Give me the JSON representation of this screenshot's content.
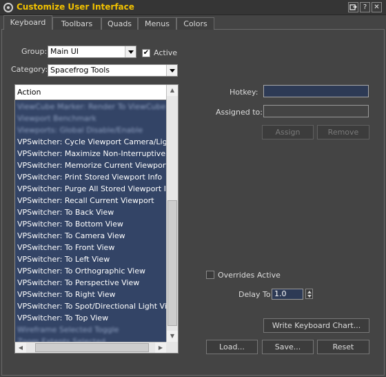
{
  "window": {
    "title": "Customize User Interface",
    "controls": {
      "help_label": "?",
      "close_label": "✕",
      "pin_icon": "dock-icon"
    }
  },
  "tabs": [
    {
      "label": "Keyboard",
      "active": true
    },
    {
      "label": "Toolbars",
      "active": false
    },
    {
      "label": "Quads",
      "active": false
    },
    {
      "label": "Menus",
      "active": false
    },
    {
      "label": "Colors",
      "active": false
    }
  ],
  "group": {
    "label": "Group:",
    "value": "Main UI"
  },
  "active": {
    "label": "Active",
    "checked": true
  },
  "category": {
    "label": "Category:",
    "value": "Spacefrog Tools"
  },
  "action_list": {
    "header": "Action",
    "rows": [
      {
        "text": "ViewCube Marker: Render To ViewCube Mod",
        "blurred": true
      },
      {
        "text": "Viewport Benchmark",
        "blurred": true
      },
      {
        "text": "Viewports: Global Disable/Enable",
        "blurred": true
      },
      {
        "text": "VPSwitcher: Cycle Viewport Camera/Light",
        "blurred": false
      },
      {
        "text": "VPSwitcher: Maximize Non-Interruptive",
        "blurred": false
      },
      {
        "text": "VPSwitcher: Memorize Current Viewport",
        "blurred": false
      },
      {
        "text": "VPSwitcher: Print Stored Viewport Info",
        "blurred": false
      },
      {
        "text": "VPSwitcher: Purge All Stored Viewport Info",
        "blurred": false
      },
      {
        "text": "VPSwitcher: Recall Current Viewport",
        "blurred": false
      },
      {
        "text": "VPSwitcher: To Back View",
        "blurred": false
      },
      {
        "text": "VPSwitcher: To Bottom View",
        "blurred": false
      },
      {
        "text": "VPSwitcher: To Camera View",
        "blurred": false
      },
      {
        "text": "VPSwitcher: To Front View",
        "blurred": false
      },
      {
        "text": "VPSwitcher: To Left View",
        "blurred": false
      },
      {
        "text": "VPSwitcher: To Orthographic View",
        "blurred": false
      },
      {
        "text": "VPSwitcher: To Perspective View",
        "blurred": false
      },
      {
        "text": "VPSwitcher: To Right View",
        "blurred": false
      },
      {
        "text": "VPSwitcher: To Spot/Directional Light View",
        "blurred": false
      },
      {
        "text": "VPSwitcher: To Top View",
        "blurred": false
      },
      {
        "text": "Wireframe Selected Toggle",
        "blurred": true
      },
      {
        "text": "Zoom Extents Selected",
        "blurred": true
      }
    ]
  },
  "hotkey": {
    "label": "Hotkey:",
    "value": ""
  },
  "assigned_to": {
    "label": "Assigned to:",
    "value": ""
  },
  "buttons": {
    "assign": "Assign",
    "remove": "Remove",
    "write_chart": "Write Keyboard Chart...",
    "load": "Load...",
    "save": "Save...",
    "reset": "Reset"
  },
  "overrides_active": {
    "label": "Overrides Active",
    "checked": false
  },
  "delay_to": {
    "label": "Delay To",
    "value": "1.0"
  },
  "colors": {
    "title": "#f0c000",
    "list_background": "#334466",
    "hotkey_field": "#2d3a55",
    "panel": "#444444"
  }
}
